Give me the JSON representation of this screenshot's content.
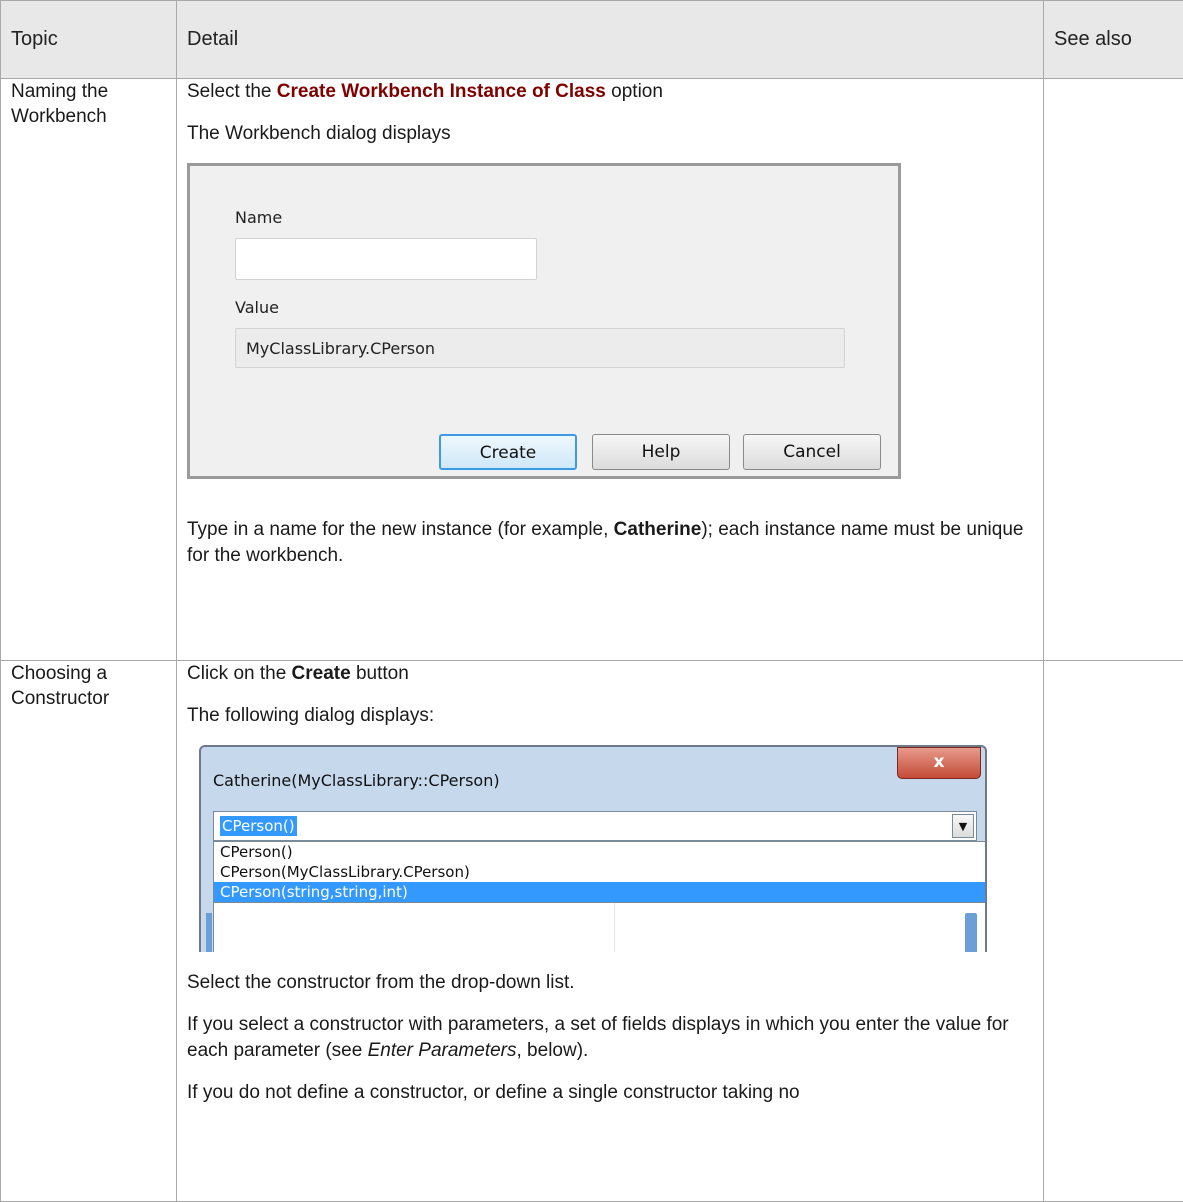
{
  "table": {
    "headers": {
      "topic": "Topic",
      "detail": "Detail",
      "see_also": "See also"
    },
    "rows": [
      {
        "topic": "Naming the Workbench",
        "p1": {
          "pre": "Select the ",
          "em": "Create Workbench Instance of Class",
          "post": " option"
        },
        "p2": "The Workbench dialog displays",
        "dialog": {
          "name_label": "Name",
          "name_value": "",
          "value_label": "Value",
          "value_text": "MyClassLibrary.CPerson",
          "create_button": "Create",
          "help_button": "Help",
          "cancel_button": "Cancel"
        },
        "p3": {
          "pre": "Type in a name for the new instance (for example, ",
          "bold": "Catherine",
          "post": "); each instance name must be unique for the workbench."
        }
      },
      {
        "topic": "Choosing a Constructor",
        "p1": {
          "pre": "Click on the ",
          "bold": "Create",
          "post": " button"
        },
        "p2": "The following dialog displays:",
        "dialog": {
          "title": "Catherine(MyClassLibrary::CPerson)",
          "close_glyph": "x",
          "selected": "CPerson()",
          "options": [
            "CPerson()",
            "CPerson(MyClassLibrary.CPerson)",
            "CPerson(string,string,int)"
          ],
          "highlighted_index": 2,
          "arrow_glyph": "▼"
        },
        "p3": "Select the constructor from the drop-down list.",
        "p4": {
          "pre": "If you select a constructor with parameters, a set of fields displays in which you enter the value  for each parameter (see ",
          "italic": "Enter Parameters",
          "post": ", below)."
        },
        "p5": "If you do not define a constructor, or define a single constructor taking no"
      }
    ]
  }
}
